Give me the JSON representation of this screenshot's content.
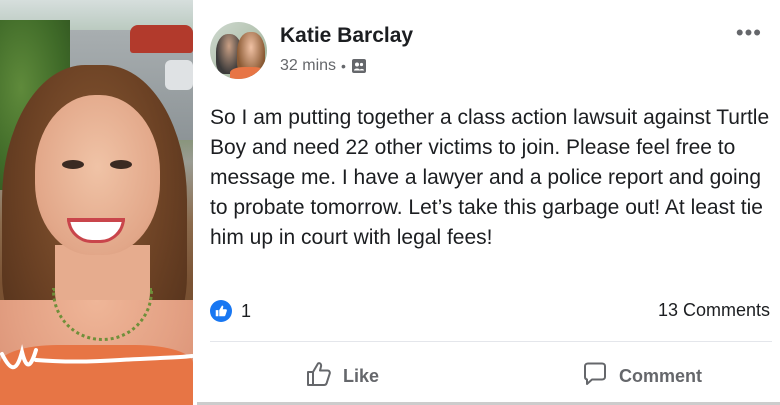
{
  "post": {
    "author": "Katie Barclay",
    "time": "32 mins",
    "separator": "•",
    "audience_icon": "group-audience-icon",
    "more_label": "•••",
    "text": "So I am putting together a class action lawsuit against Turtle Boy and need 22 other victims to join. Please feel free to message me. I have a lawyer and a police report and going to probate tomorrow. Let’s take this garbage out! At least tie him up in court with legal fees!",
    "reaction_icon": "like-reaction-icon",
    "reaction_count": "1",
    "comments_label": "13 Comments",
    "actions": {
      "like_label": "Like",
      "like_icon": "thumbs-up-icon",
      "comment_label": "Comment",
      "comment_icon": "comment-bubble-icon"
    }
  },
  "colors": {
    "name": "#1c1e21",
    "meta": "#65676b",
    "accent": "#1877f2",
    "divider": "#e4e6eb"
  }
}
